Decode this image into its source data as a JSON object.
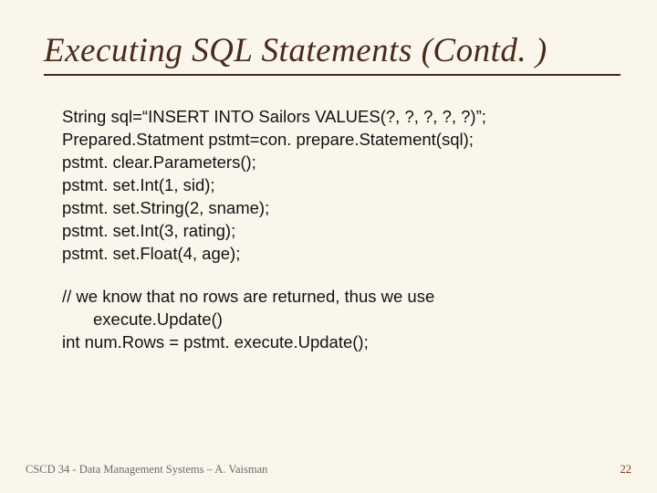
{
  "title": "Executing SQL Statements (Contd. )",
  "code": {
    "l1": "String sql=“INSERT INTO Sailors VALUES(?, ?, ?, ?, ?)”;",
    "l2": "Prepared.Statment pstmt=con. prepare.Statement(sql);",
    "l3": "pstmt. clear.Parameters();",
    "l4": "pstmt. set.Int(1, sid);",
    "l5": "pstmt. set.String(2, sname);",
    "l6": "pstmt. set.Int(3, rating);",
    "l7": "pstmt. set.Float(4, age);",
    "l8": "// we know that no rows are returned, thus we use",
    "l8b": "execute.Update()",
    "l9": "int num.Rows = pstmt. execute.Update();"
  },
  "footer": {
    "left": "CSCD 34 - Data Management Systems – A. Vaisman",
    "pageno": "22"
  }
}
